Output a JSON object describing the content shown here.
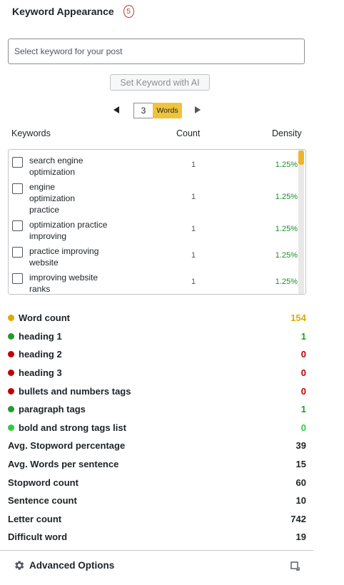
{
  "header": {
    "title": "Keyword Appearance",
    "badge": "5"
  },
  "keyword_input": {
    "placeholder": "Select keyword for your post",
    "value": ""
  },
  "ai_button": {
    "label": "Set Keyword with AI"
  },
  "words_selector": {
    "value": "3",
    "label": "Words",
    "prev_icon": "triangle-left-icon",
    "next_icon": "triangle-right-icon"
  },
  "table": {
    "headers": {
      "keywords": "Keywords",
      "count": "Count",
      "density": "Density"
    },
    "rows": [
      {
        "keyword": "search engine optimization",
        "count": "1",
        "density": "1.25%"
      },
      {
        "keyword": "engine optimization practice",
        "count": "1",
        "density": "1.25%"
      },
      {
        "keyword": "optimization practice improving",
        "count": "1",
        "density": "1.25%"
      },
      {
        "keyword": "practice improving website",
        "count": "1",
        "density": "1.25%"
      },
      {
        "keyword": "improving website ranks",
        "count": "1",
        "density": "1.25%"
      }
    ]
  },
  "metrics": [
    {
      "label": "Word count",
      "value": "154",
      "dot": "#e0a800",
      "color": "#e0a800"
    },
    {
      "label": "heading 1",
      "value": "1",
      "dot": "#1e9c2c",
      "color": "#1e9c2c"
    },
    {
      "label": "heading 2",
      "value": "0",
      "dot": "#c00000",
      "color": "#c00000"
    },
    {
      "label": "heading 3",
      "value": "0",
      "dot": "#c00000",
      "color": "#c00000"
    },
    {
      "label": "bullets and numbers tags",
      "value": "0",
      "dot": "#c00000",
      "color": "#c00000"
    },
    {
      "label": "paragraph tags",
      "value": "1",
      "dot": "#1e9c2c",
      "color": "#1e9c2c"
    },
    {
      "label": "bold and strong tags list",
      "value": "0",
      "dot": "#2ecc40",
      "color": "#2ecc40"
    },
    {
      "label": "Avg. Stopword percentage",
      "value": "39",
      "dot": null,
      "color": "#1d2327"
    },
    {
      "label": "Avg. Words per sentence",
      "value": "15",
      "dot": null,
      "color": "#1d2327"
    },
    {
      "label": "Stopword count",
      "value": "60",
      "dot": null,
      "color": "#1d2327"
    },
    {
      "label": "Sentence count",
      "value": "10",
      "dot": null,
      "color": "#1d2327"
    },
    {
      "label": "Letter count",
      "value": "742",
      "dot": null,
      "color": "#1d2327"
    },
    {
      "label": "Difficult word",
      "value": "19",
      "dot": null,
      "color": "#1d2327"
    }
  ],
  "advanced": {
    "label": "Advanced Options",
    "icon": "gear-icon",
    "expand_icon": "expand-icon"
  }
}
